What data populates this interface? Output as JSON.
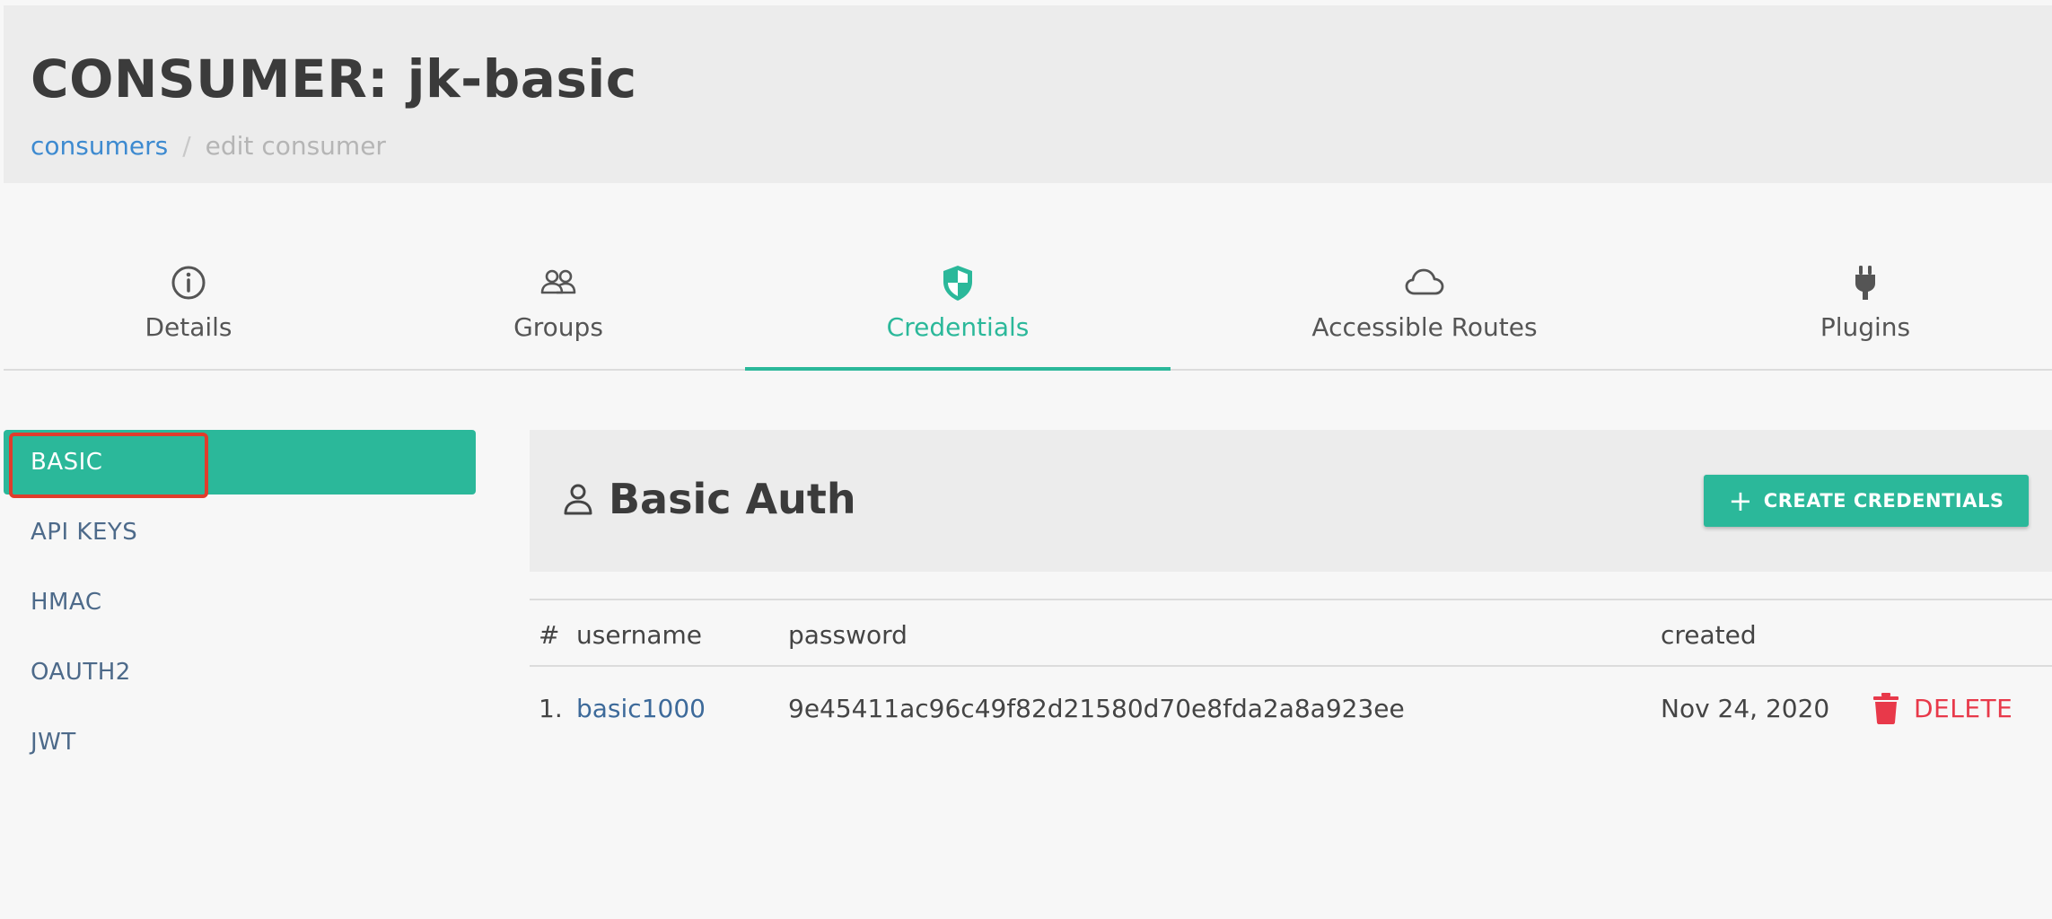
{
  "header": {
    "title": "CONSUMER: jk-basic",
    "breadcrumb": {
      "parent": "consumers",
      "separator": "/",
      "current": "edit consumer"
    }
  },
  "tabs": [
    {
      "label": "Details",
      "icon": "info-circle-icon"
    },
    {
      "label": "Groups",
      "icon": "users-icon"
    },
    {
      "label": "Credentials",
      "icon": "shield-icon",
      "active": true
    },
    {
      "label": "Accessible Routes",
      "icon": "cloud-icon"
    },
    {
      "label": "Plugins",
      "icon": "plug-icon"
    }
  ],
  "sidebar": {
    "items": [
      {
        "label": "BASIC",
        "active": true
      },
      {
        "label": "API KEYS"
      },
      {
        "label": "HMAC"
      },
      {
        "label": "OAUTH2"
      },
      {
        "label": "JWT"
      }
    ]
  },
  "panel": {
    "title": "Basic Auth",
    "title_icon": "user-icon",
    "create_label": "CREATE CREDENTIALS"
  },
  "table": {
    "columns": {
      "num": "#",
      "username": "username",
      "password": "password",
      "created": "created"
    },
    "rows": [
      {
        "num": "1.",
        "username": "basic1000",
        "password": "9e45411ac96c49f82d21580d70e8fda2a8a923ee",
        "created": "Nov 24, 2020",
        "delete_label": "DELETE"
      }
    ]
  },
  "colors": {
    "accent": "#2bb89a",
    "link": "#3d8ad0",
    "danger": "#e8394a",
    "highlight": "#e03c2c"
  }
}
